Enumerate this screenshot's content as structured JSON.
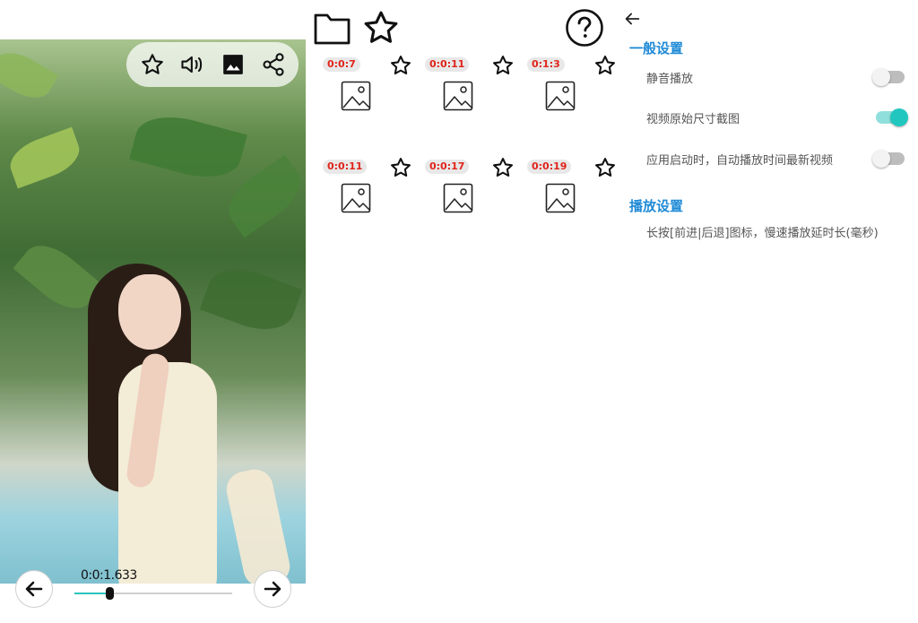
{
  "video": {
    "current_time": "0:0:1.633",
    "progress": 0.22,
    "toolbar_icons": [
      "star-icon",
      "volume-icon",
      "image-icon",
      "share-icon"
    ],
    "prev_icon": "arrow-left-icon",
    "next_icon": "arrow-right-icon"
  },
  "top_bar": {
    "icons": [
      "folder-icon",
      "star-icon",
      "help-icon"
    ]
  },
  "clips": [
    {
      "time": "0:0:7"
    },
    {
      "time": "0:0:11"
    },
    {
      "time": "0:1:3"
    },
    {
      "time": "0:0:11"
    },
    {
      "time": "0:0:17"
    },
    {
      "time": "0:0:19"
    }
  ],
  "settings": {
    "general_title": "一般设置",
    "mute_label": "静音播放",
    "mute_on": false,
    "original_size_label": "视频原始尺寸截图",
    "original_size_on": true,
    "autoplay_label": "应用启动时，自动播放时间最新视频",
    "autoplay_on": false,
    "playback_title": "播放设置",
    "long_press_label": "长按[前进|后退]图标，慢速播放延时长(毫秒)"
  },
  "colors": {
    "accent": "#1f8ad6",
    "toggle_on": "#21c7bf",
    "time_badge_text": "#e0241b",
    "slider_fill": "#29c4be"
  }
}
